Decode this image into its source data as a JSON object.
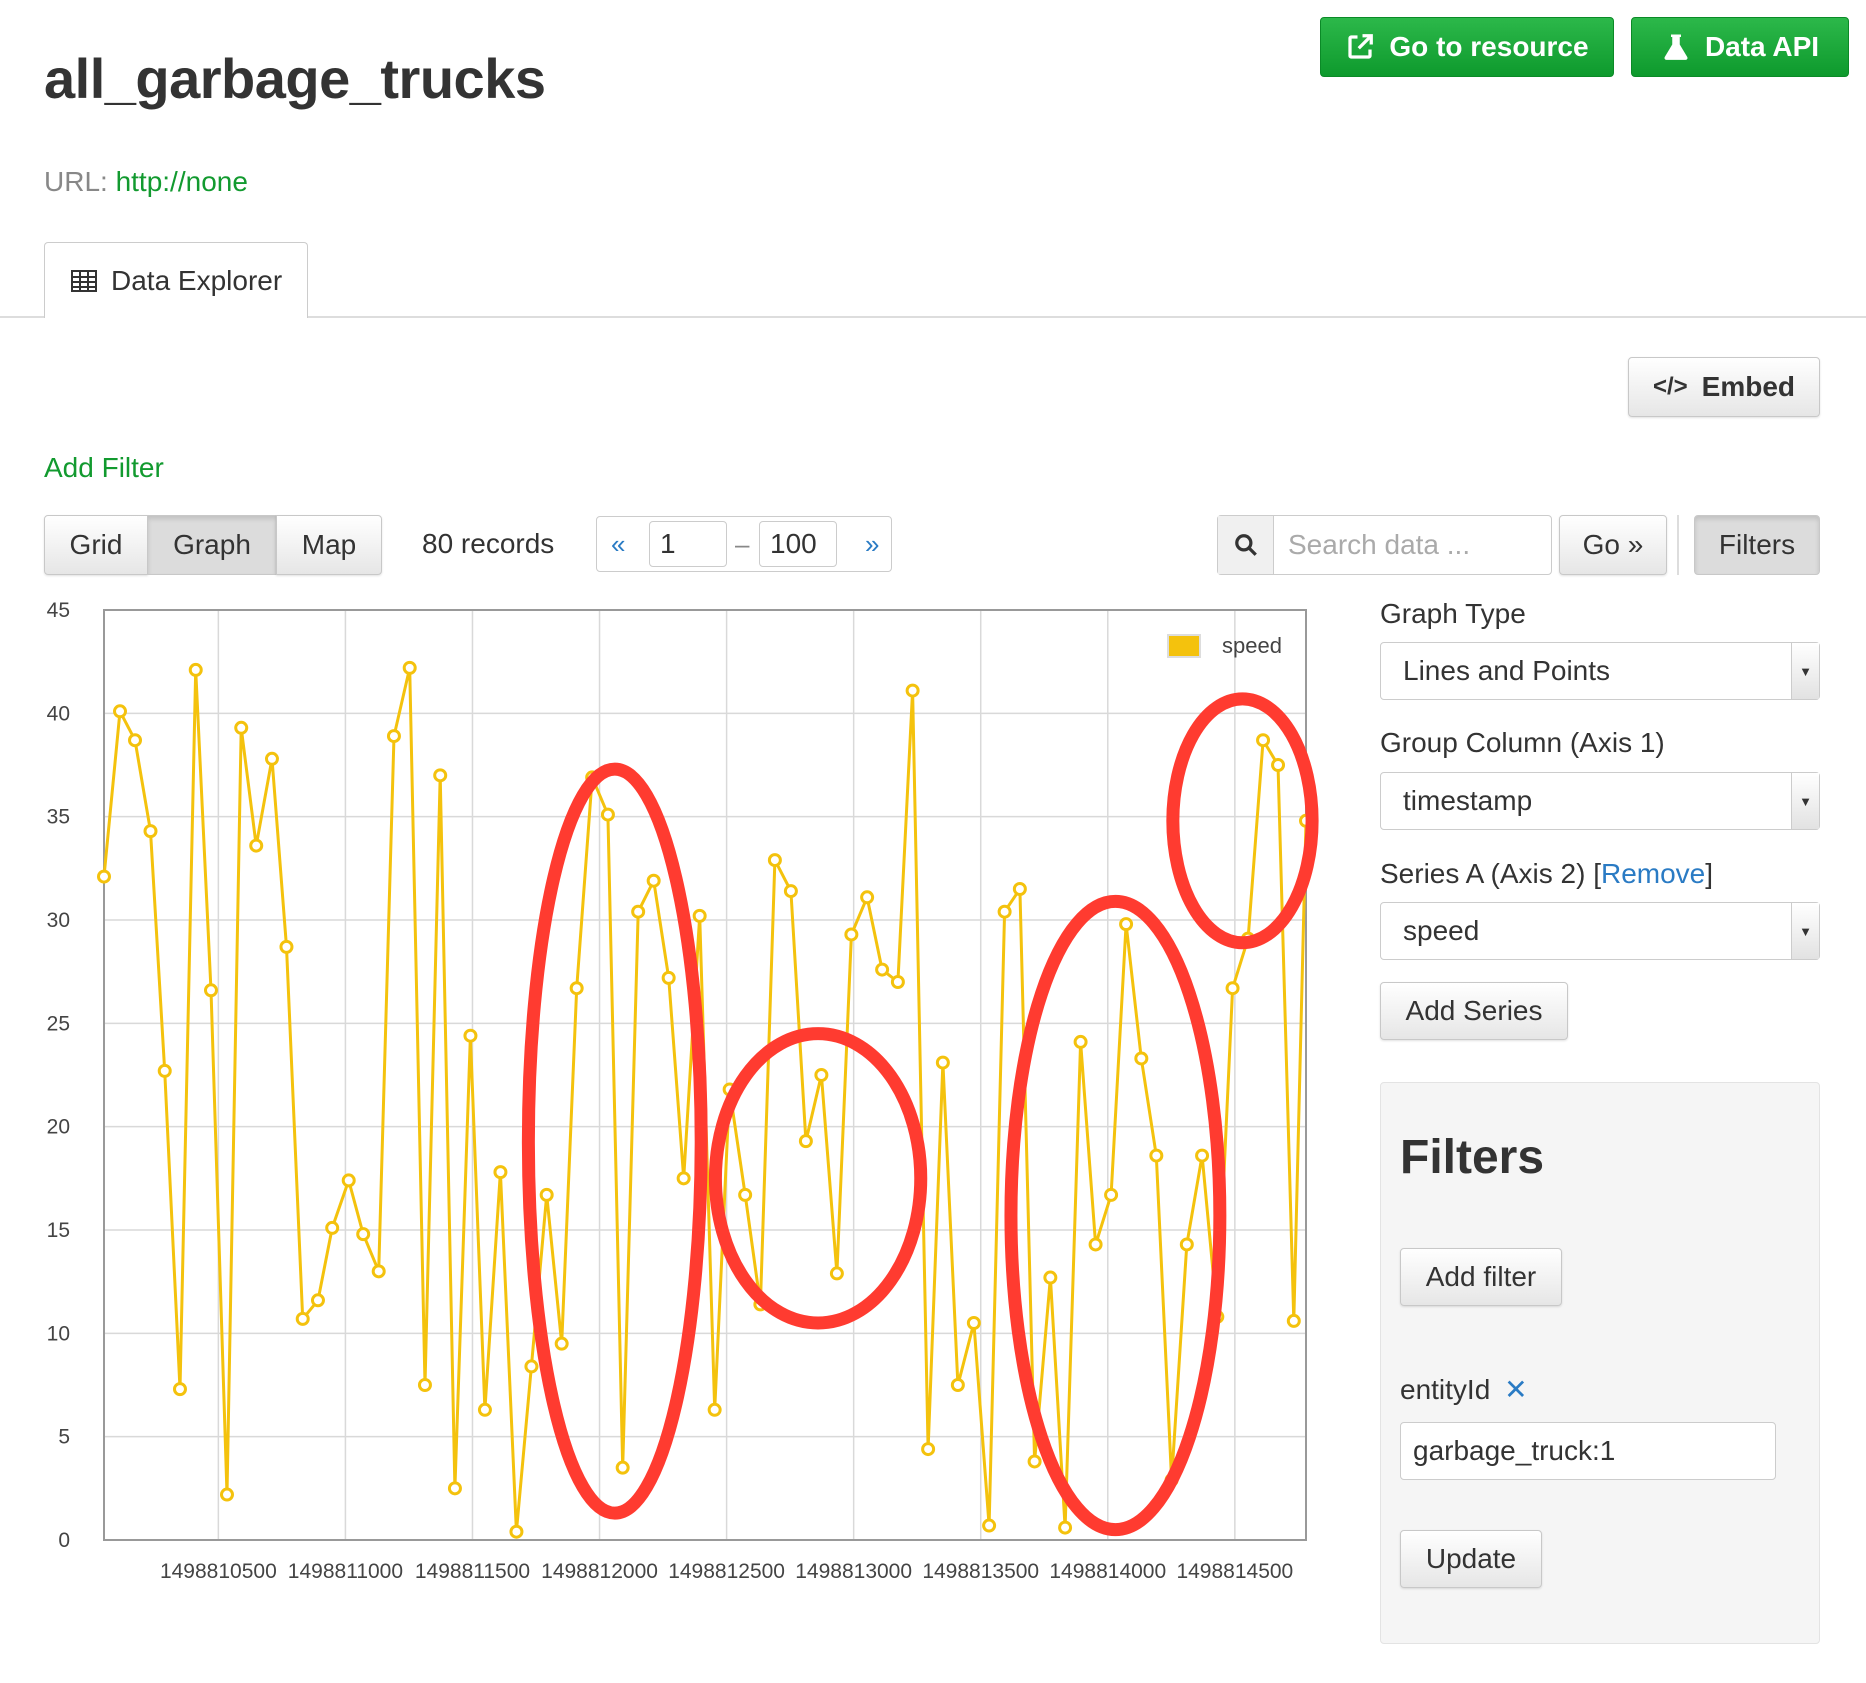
{
  "page": {
    "title": "all_garbage_trucks",
    "url_label": "URL:",
    "url_value": "http://none"
  },
  "header_buttons": {
    "go_to_resource": "Go to resource",
    "data_api": "Data API"
  },
  "tabs": [
    {
      "label": "Data Explorer",
      "icon": "table-icon"
    }
  ],
  "embed_label": "Embed",
  "add_filter_link": "Add Filter",
  "view_switch": [
    "Grid",
    "Graph",
    "Map"
  ],
  "active_view": "Graph",
  "records": "80 records",
  "pager": {
    "prev": "«",
    "next": "»",
    "from": "1",
    "dash": "–",
    "to": "100"
  },
  "search": {
    "placeholder": "Search data ...",
    "go_label": "Go »",
    "filters_label": "Filters"
  },
  "editor": {
    "graph_type_label": "Graph Type",
    "graph_type_value": "Lines and Points",
    "group_column_label": "Group Column (Axis 1)",
    "group_column_value": "timestamp",
    "series_label": "Series A (Axis 2)",
    "remove_open": "[",
    "remove_label": "Remove",
    "remove_close": "]",
    "series_value": "speed",
    "add_series": "Add Series"
  },
  "filters_panel": {
    "heading": "Filters",
    "add_filter": "Add filter",
    "field_name": "entityId",
    "field_value": "garbage_truck:1",
    "update": "Update"
  },
  "colors": {
    "series": "#f4c20d",
    "highlight": "#ff3b30",
    "brand_green": "#129a2f",
    "link_blue": "#2a7bc4"
  },
  "chart_data": {
    "type": "line",
    "title": "",
    "xlabel": "",
    "ylabel": "",
    "legend_position": "top-right",
    "grid": true,
    "ylim": [
      0,
      45
    ],
    "xlim": [
      1498810050,
      1498814780
    ],
    "y_ticks": [
      0,
      5,
      10,
      15,
      20,
      25,
      30,
      35,
      40,
      45
    ],
    "x_ticks": [
      1498810500,
      1498811000,
      1498811500,
      1498812000,
      1498812500,
      1498813000,
      1498813500,
      1498814000,
      1498814500
    ],
    "series": [
      {
        "name": "speed",
        "color": "#f4c20d",
        "x": [
          1498810050,
          1498810113,
          1498810172,
          1498810233,
          1498810289,
          1498810349,
          1498810411,
          1498810471,
          1498810534,
          1498810590,
          1498810649,
          1498810711,
          1498810768,
          1498810832,
          1498810892,
          1498810948,
          1498811013,
          1498811070,
          1498811131,
          1498811191,
          1498811253,
          1498811313,
          1498811373,
          1498811431,
          1498811492,
          1498811549,
          1498811610,
          1498811673,
          1498811732,
          1498811792,
          1498811851,
          1498811910,
          1498811971,
          1498812033,
          1498812091,
          1498812152,
          1498812213,
          1498812272,
          1498812331,
          1498812394,
          1498812453,
          1498812512,
          1498812573,
          1498812633,
          1498812690,
          1498812753,
          1498812812,
          1498812873,
          1498812934,
          1498812991,
          1498813053,
          1498813112,
          1498813174,
          1498813232,
          1498813293,
          1498813351,
          1498813410,
          1498813473,
          1498813533,
          1498813594,
          1498813654,
          1498813712,
          1498813774,
          1498813832,
          1498813893,
          1498813952,
          1498814013,
          1498814072,
          1498814132,
          1498814191,
          1498814251,
          1498814311,
          1498814371,
          1498814431,
          1498814491,
          1498814552,
          1498814611,
          1498814670,
          1498814732,
          1498814780
        ],
        "values": [
          32.1,
          40.1,
          38.7,
          34.3,
          22.7,
          7.3,
          42.1,
          26.6,
          2.2,
          39.3,
          33.6,
          37.8,
          28.7,
          10.7,
          11.6,
          15.1,
          17.4,
          14.8,
          13.0,
          38.9,
          42.2,
          7.5,
          37.0,
          2.5,
          24.4,
          6.3,
          17.8,
          0.4,
          8.4,
          16.7,
          9.5,
          26.7,
          36.9,
          35.1,
          3.5,
          30.4,
          31.9,
          27.2,
          17.5,
          30.2,
          6.3,
          21.8,
          16.7,
          11.4,
          32.9,
          31.4,
          19.3,
          22.5,
          12.9,
          29.3,
          31.1,
          27.6,
          27.0,
          41.1,
          4.4,
          23.1,
          7.5,
          10.5,
          0.7,
          30.4,
          31.5,
          3.8,
          12.7,
          0.6,
          24.1,
          14.3,
          16.7,
          29.8,
          23.3,
          18.6,
          2.9,
          14.3,
          18.6,
          10.8,
          26.7,
          29.1,
          38.7,
          37.5,
          10.6,
          34.8
        ]
      }
    ],
    "annotations": [
      {
        "type": "ellipse",
        "cx": 1498812060,
        "cy": 19.3,
        "rx": 340,
        "ry": 18.0
      },
      {
        "type": "ellipse",
        "cx": 1498812860,
        "cy": 17.5,
        "rx": 404,
        "ry": 7.0
      },
      {
        "type": "ellipse",
        "cx": 1498814030,
        "cy": 15.7,
        "rx": 411,
        "ry": 15.2
      },
      {
        "type": "ellipse",
        "cx": 1498814530,
        "cy": 34.8,
        "rx": 274,
        "ry": 5.9
      }
    ]
  }
}
